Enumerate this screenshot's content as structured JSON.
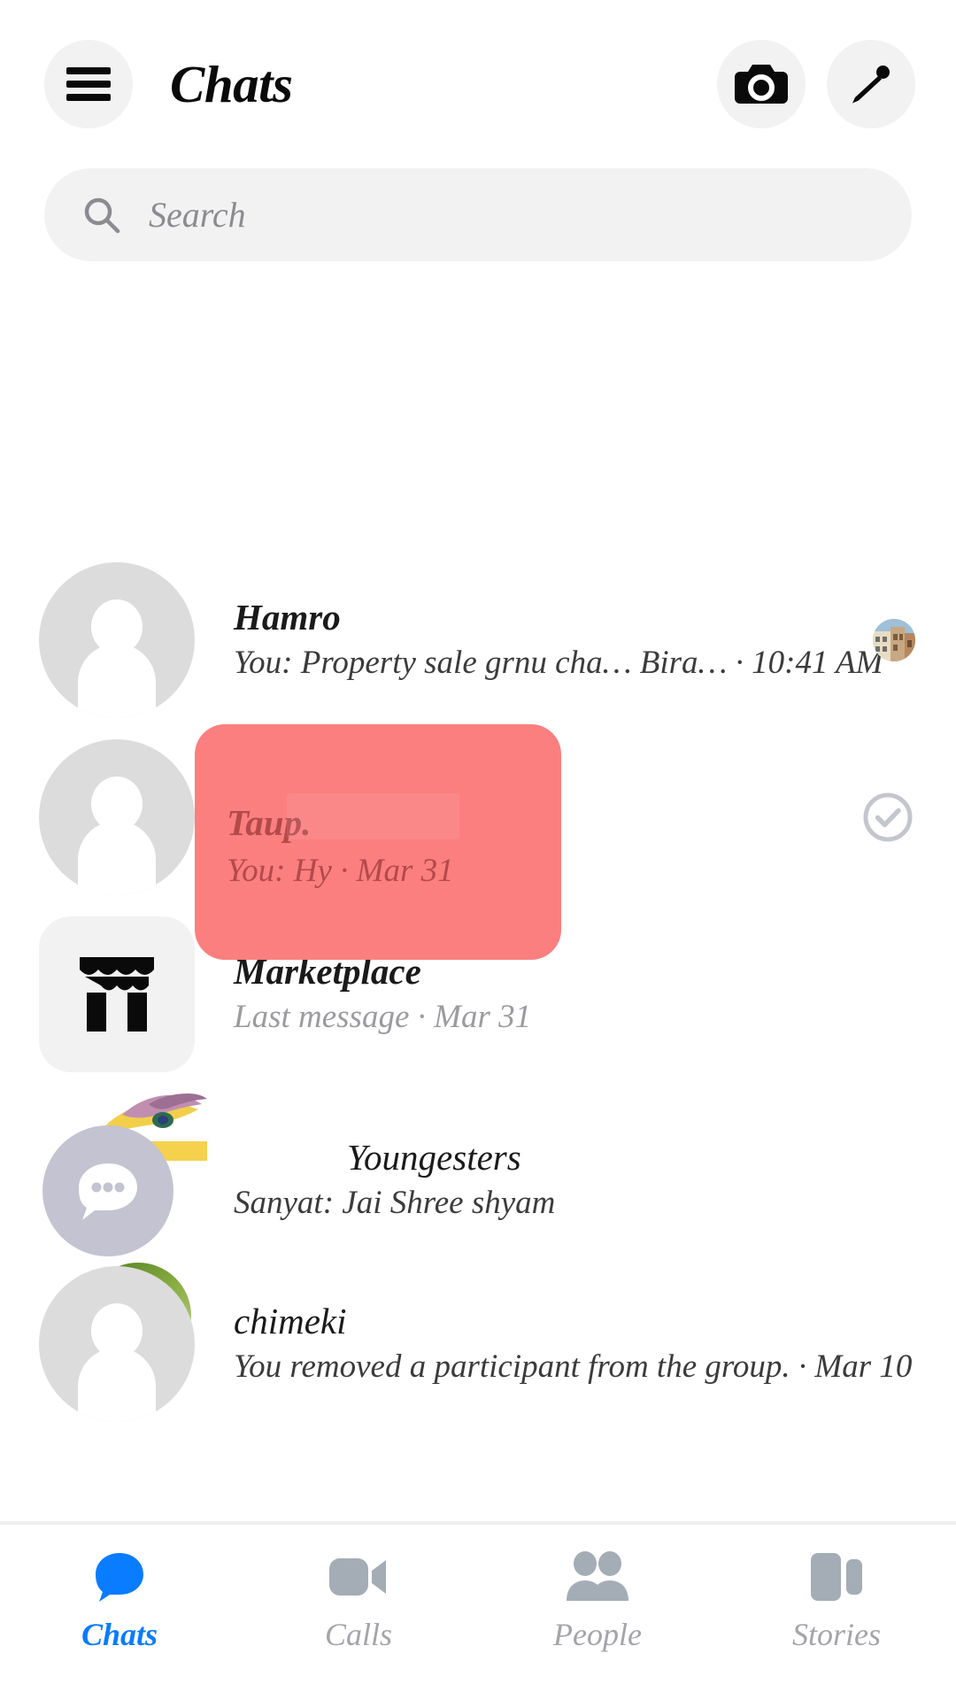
{
  "header": {
    "title": "Chats",
    "menu_icon": "hamburger-menu-icon",
    "camera_icon": "camera-icon",
    "edit_icon": "pencil-edit-icon"
  },
  "search": {
    "placeholder": "Search",
    "value": "",
    "icon": "search-icon"
  },
  "colors": {
    "accent_blue": "#0a7cff",
    "annotation_red": "#fb7f7f",
    "avatar_gray": "#dcdcdd",
    "chip_gray": "#f2f2f3",
    "muted_text": "#9b9b9f"
  },
  "chats": [
    {
      "name": "Hamro",
      "snippet": "You: Property sale grnu cha… Bira… · 10:41 AM",
      "avatar": "default-person-avatar",
      "right_icon": "building-photo-thumbnail",
      "muted": false
    },
    {
      "name": "Taup.",
      "snippet": "You: Hy · Mar 31",
      "avatar": "default-person-avatar",
      "right_icon": "check-circle-icon",
      "highlighted": true,
      "muted": false
    },
    {
      "name": "Marketplace",
      "snippet": "Last message · Mar 31",
      "avatar": "marketplace-store-icon",
      "right_icon": "",
      "muted": true
    },
    {
      "name": "Youngesters",
      "snippet": "Sanyat: Jai Shree shyam",
      "avatar": "group-chat-bubble-avatar",
      "right_icon": "",
      "muted": false
    },
    {
      "name": "chimeki",
      "snippet": "You removed a participant from the group. · Mar 10",
      "avatar": "default-person-avatar",
      "right_icon": "",
      "muted": false
    }
  ],
  "bottom_nav": [
    {
      "label": "Chats",
      "icon": "chat-bubble-icon",
      "active": true
    },
    {
      "label": "Calls",
      "icon": "video-camera-icon",
      "active": false
    },
    {
      "label": "People",
      "icon": "people-icon",
      "active": false
    },
    {
      "label": "Stories",
      "icon": "stories-icon",
      "active": false
    }
  ]
}
